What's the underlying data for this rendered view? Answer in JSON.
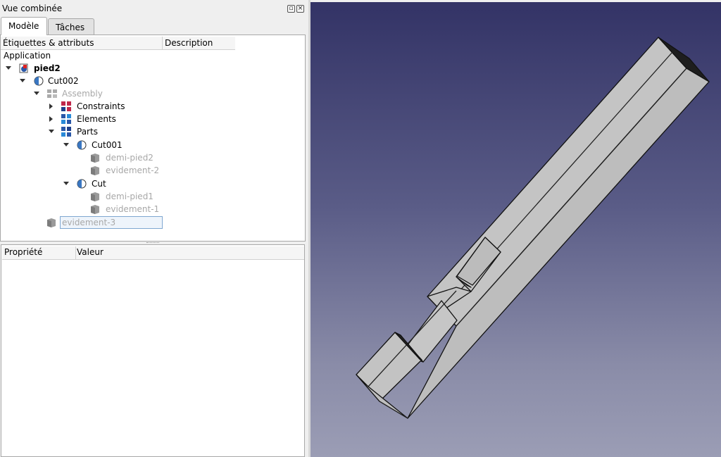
{
  "combo_view": {
    "title": "Vue combinée",
    "tabs": [
      {
        "label": "Modèle"
      },
      {
        "label": "Tâches"
      }
    ]
  },
  "tree": {
    "columns": [
      "Étiquettes & attributs",
      "Description"
    ],
    "root_label": "Application",
    "items": [
      {
        "label": "pied2",
        "icon": "document-icon"
      },
      {
        "label": "Cut002",
        "icon": "cut-icon"
      },
      {
        "label": "Assembly",
        "icon": "assembly-icon"
      },
      {
        "label": "Constraints",
        "icon": "constraints-icon"
      },
      {
        "label": "Elements",
        "icon": "elements-icon"
      },
      {
        "label": "Parts",
        "icon": "parts-icon"
      },
      {
        "label": "Cut001",
        "icon": "cut-icon"
      },
      {
        "label": "demi-pied2",
        "icon": "box-icon"
      },
      {
        "label": "evidement-2",
        "icon": "box-icon"
      },
      {
        "label": "Cut",
        "icon": "cut-icon"
      },
      {
        "label": "demi-pied1",
        "icon": "box-icon"
      },
      {
        "label": "evidement-1",
        "icon": "box-icon"
      },
      {
        "label": "evidement-3",
        "icon": "box-icon"
      }
    ]
  },
  "properties": {
    "columns": [
      "Propriété",
      "Valeur"
    ]
  },
  "colors": {
    "viewport_top": "#333366",
    "viewport_bottom": "#9b9db5",
    "model_face": "#c0c0c0",
    "selection": "#eef4fb"
  }
}
